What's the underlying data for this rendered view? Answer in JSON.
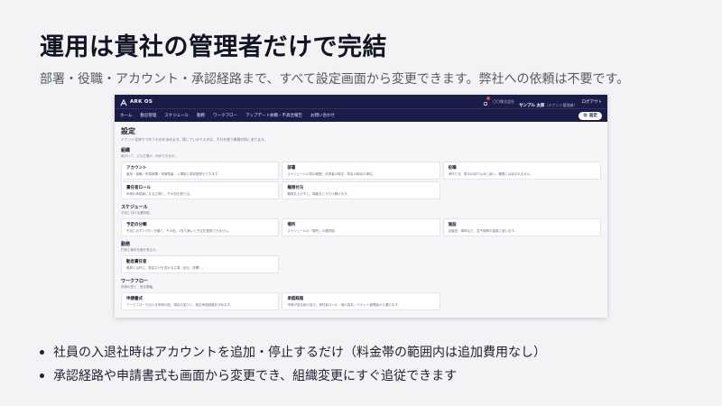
{
  "slide": {
    "title": "運用は貴社の管理者だけで完結",
    "subtitle": "部署・役職・アカウント・承認経路まで、すべて設定画面から変更できます。弊社への依頼は不要です。",
    "bullets": [
      "社員の入退社時はアカウントを追加・停止するだけ（料金帯の範囲内は追加費用なし）",
      "承認経路や申請書式も画面から変更でき、組織変更にすぐ追従できます"
    ]
  },
  "app": {
    "logo_text": "ARK OS",
    "icons": {
      "logo": "ark-logo-icon",
      "bell": "bell-icon",
      "gear": "gear-icon"
    },
    "colors": {
      "header_bg": "#1b1d48",
      "badge": "#e04848",
      "page_bg": "#f6f6f9"
    },
    "header": {
      "company": "〇〇株式会社",
      "user": "サンプル 太郎",
      "user_role": "（テナント管理者）",
      "logout": "ログアウト"
    },
    "nav": {
      "items": [
        "ホーム",
        "勤怠管理",
        "スケジュール",
        "勤務",
        "ワークフロー",
        "アップデート依頼・不具合報告",
        "お問い合わせ"
      ],
      "settings_label": "設定"
    },
    "page": {
      "title": "設定",
      "description": "テナント全体でつかうものを決めます。探しているマスタは、それを使う業務の所にあります。",
      "sections": [
        {
          "title": "組織",
          "description": "誰がいて、どの立場か、何ができるか。",
          "cards": [
            {
              "title": "アカウント",
              "desc": "雇用・役職・所属部署・有権限者、入場前に事前登録もできます。"
            },
            {
              "title": "部署",
              "desc": "スケジュールの表示範囲・決済者の既定・勤怠の締めの単位。"
            },
            {
              "title": "役職",
              "desc": "承作りき、表示の絞り込みに使い、権限には含まれません。"
            },
            {
              "title": "責任者ロール",
              "desc": "申請の承認者になる立場と、その担を割り当。"
            },
            {
              "title": "権限付与",
              "desc": "職責を上げずに、機能をとりだけ解けます。"
            }
          ]
        },
        {
          "title": "スケジュール",
          "description": "予定に付ける選択肢。",
          "cards": [
            {
              "title": "予定の分類",
              "desc": "予定に必ず1つ付く分類と、その色。2件も無いと予定を登録できません。"
            },
            {
              "title": "場所",
              "desc": "スケジュールの「場所」の選択肢。"
            },
            {
              "title": "施設",
              "desc": "会議室・車両など、並予時間の重複に使います。"
            }
          ]
        },
        {
          "title": "勤務",
          "description": "打刻と締めを誰が見るか。",
          "cards": [
            {
              "title": "勤怠責任者",
              "desc": "職員とは別に、勤怠だけを見れる立場（全社／部署）。"
            }
          ]
        },
        {
          "title": "ワークフロー",
          "description": "申請の型と、回る順番。",
          "cards": [
            {
              "title": "申請書式",
              "desc": "ワークフローで出せる申請の型。項目の並びと、既定承認経路を決めます。"
            },
            {
              "title": "承認経路",
              "desc": "申請が回る段の並び。責任者ロール・個人指名・テナント管理者から選びます。"
            }
          ]
        }
      ]
    }
  }
}
